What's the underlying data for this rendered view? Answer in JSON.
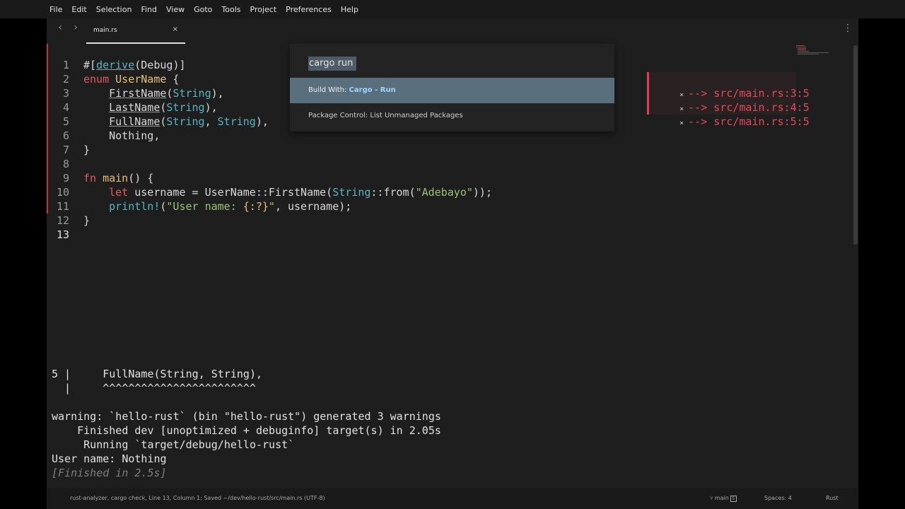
{
  "menu": [
    "File",
    "Edit",
    "Selection",
    "Find",
    "View",
    "Goto",
    "Tools",
    "Project",
    "Preferences",
    "Help"
  ],
  "tab": {
    "label": "main.rs",
    "close": "×"
  },
  "nav": {
    "back": "‹",
    "forward": "›"
  },
  "kebab": "⋮",
  "palette": {
    "query": "cargo run",
    "items": [
      {
        "prefix": "Build With: ",
        "match": "Cargo - Run",
        "suffix": ""
      },
      {
        "prefix": "Package Control: List Unmanaged Packages",
        "match": "",
        "suffix": ""
      }
    ]
  },
  "diagnostics": [
    {
      "icon": "×",
      "text": "--> src/main.rs:3:5"
    },
    {
      "icon": "×",
      "text": "--> src/main.rs:4:5"
    },
    {
      "icon": "×",
      "text": "--> src/main.rs:5:5"
    }
  ],
  "line_numbers": [
    "1",
    "2",
    "3",
    "4",
    "5",
    "6",
    "7",
    "8",
    "9",
    "10",
    "11",
    "12",
    "13"
  ],
  "output_lines": [
    "5 |     FullName(String, String),",
    "  |     ^^^^^^^^^^^^^^^^^^^^^^^^",
    "",
    "warning: `hello-rust` (bin \"hello-rust\") generated 3 warnings",
    "    Finished dev [unoptimized + debuginfo] target(s) in 2.05s",
    "     Running `target/debug/hello-rust`",
    "User name: Nothing",
    "[Finished in 2.5s]"
  ],
  "status": {
    "left": "rust-analyzer, cargo check, Line 13, Column 1; Saved ~/dev/hello-rust/src/main.rs (UTF-8)",
    "branch": "main",
    "badge": "5",
    "spaces": "Spaces: 4",
    "syntax": "Rust"
  }
}
